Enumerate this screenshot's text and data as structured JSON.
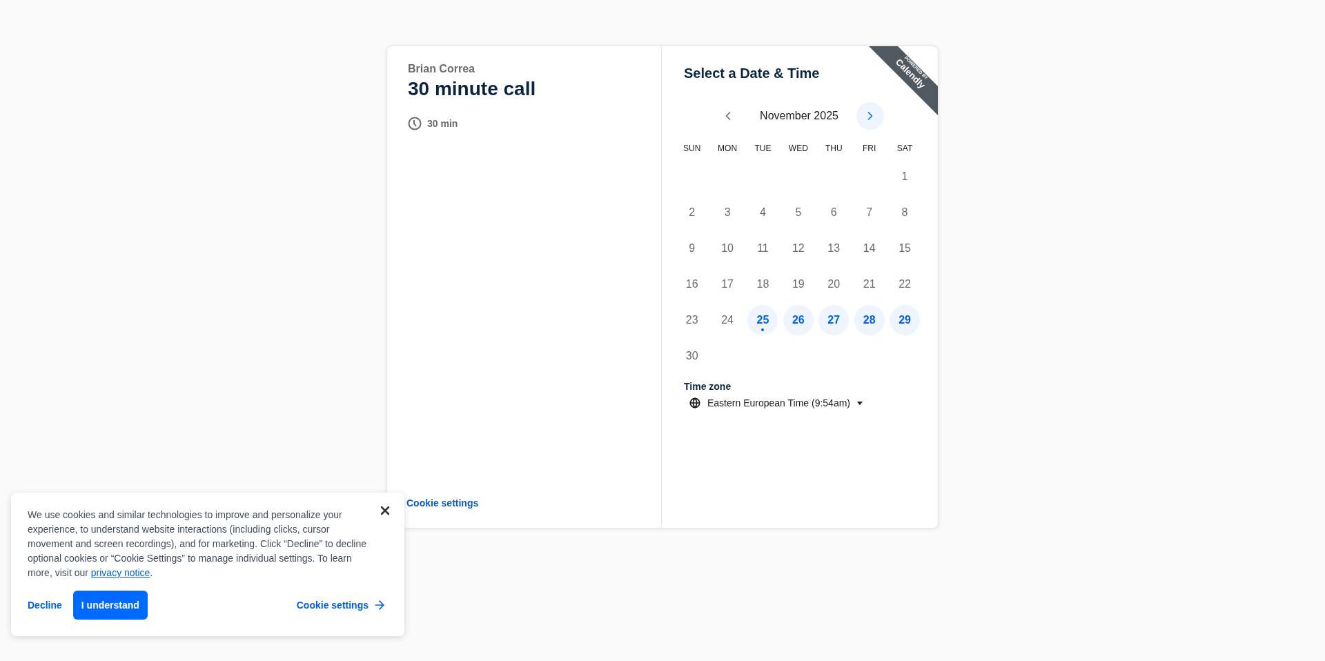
{
  "event": {
    "host": "Brian Correa",
    "title": "30 minute call",
    "duration": "30 min"
  },
  "footer_link": "Cookie settings",
  "ribbon": {
    "top": "POWERED BY",
    "brand": "Calendly"
  },
  "calendar": {
    "title": "Select a Date & Time",
    "month": "November 2025",
    "prev_disabled": true,
    "next_disabled": false,
    "weekdays": [
      "SUN",
      "MON",
      "TUE",
      "WED",
      "THU",
      "FRI",
      "SAT"
    ],
    "weeks": [
      [
        {
          "kind": "blank"
        },
        {
          "kind": "blank"
        },
        {
          "kind": "blank"
        },
        {
          "kind": "blank"
        },
        {
          "kind": "blank"
        },
        {
          "kind": "blank"
        },
        {
          "kind": "day",
          "label": "1",
          "available": false,
          "today": false
        }
      ],
      [
        {
          "kind": "day",
          "label": "2",
          "available": false,
          "today": false
        },
        {
          "kind": "day",
          "label": "3",
          "available": false,
          "today": false
        },
        {
          "kind": "day",
          "label": "4",
          "available": false,
          "today": false
        },
        {
          "kind": "day",
          "label": "5",
          "available": false,
          "today": false
        },
        {
          "kind": "day",
          "label": "6",
          "available": false,
          "today": false
        },
        {
          "kind": "day",
          "label": "7",
          "available": false,
          "today": false
        },
        {
          "kind": "day",
          "label": "8",
          "available": false,
          "today": false
        }
      ],
      [
        {
          "kind": "day",
          "label": "9",
          "available": false,
          "today": false
        },
        {
          "kind": "day",
          "label": "10",
          "available": false,
          "today": false
        },
        {
          "kind": "day",
          "label": "11",
          "available": false,
          "today": false
        },
        {
          "kind": "day",
          "label": "12",
          "available": false,
          "today": false
        },
        {
          "kind": "day",
          "label": "13",
          "available": false,
          "today": false
        },
        {
          "kind": "day",
          "label": "14",
          "available": false,
          "today": false
        },
        {
          "kind": "day",
          "label": "15",
          "available": false,
          "today": false
        }
      ],
      [
        {
          "kind": "day",
          "label": "16",
          "available": false,
          "today": false
        },
        {
          "kind": "day",
          "label": "17",
          "available": false,
          "today": false
        },
        {
          "kind": "day",
          "label": "18",
          "available": false,
          "today": false
        },
        {
          "kind": "day",
          "label": "19",
          "available": false,
          "today": false
        },
        {
          "kind": "day",
          "label": "20",
          "available": false,
          "today": false
        },
        {
          "kind": "day",
          "label": "21",
          "available": false,
          "today": false
        },
        {
          "kind": "day",
          "label": "22",
          "available": false,
          "today": false
        }
      ],
      [
        {
          "kind": "day",
          "label": "23",
          "available": false,
          "today": false
        },
        {
          "kind": "day",
          "label": "24",
          "available": false,
          "today": false
        },
        {
          "kind": "day",
          "label": "25",
          "available": true,
          "today": true
        },
        {
          "kind": "day",
          "label": "26",
          "available": true,
          "today": false
        },
        {
          "kind": "day",
          "label": "27",
          "available": true,
          "today": false
        },
        {
          "kind": "day",
          "label": "28",
          "available": true,
          "today": false
        },
        {
          "kind": "day",
          "label": "29",
          "available": true,
          "today": false
        }
      ],
      [
        {
          "kind": "day",
          "label": "30",
          "available": false,
          "today": false
        }
      ]
    ]
  },
  "timezone": {
    "label": "Time zone",
    "value": "Eastern European Time (9:54am)"
  },
  "cookie_banner": {
    "text_before": "We use cookies and similar technologies to improve and personalize your experience, to understand website interactions (including clicks, cursor movement and screen recordings), and for marketing. Click “Decline” to decline optional cookies or “Cookie Settings” to manage individual settings. To learn more, visit our ",
    "link": "privacy notice",
    "text_after": ".",
    "decline": "Decline",
    "accept": "I understand",
    "settings": "Cookie settings"
  }
}
